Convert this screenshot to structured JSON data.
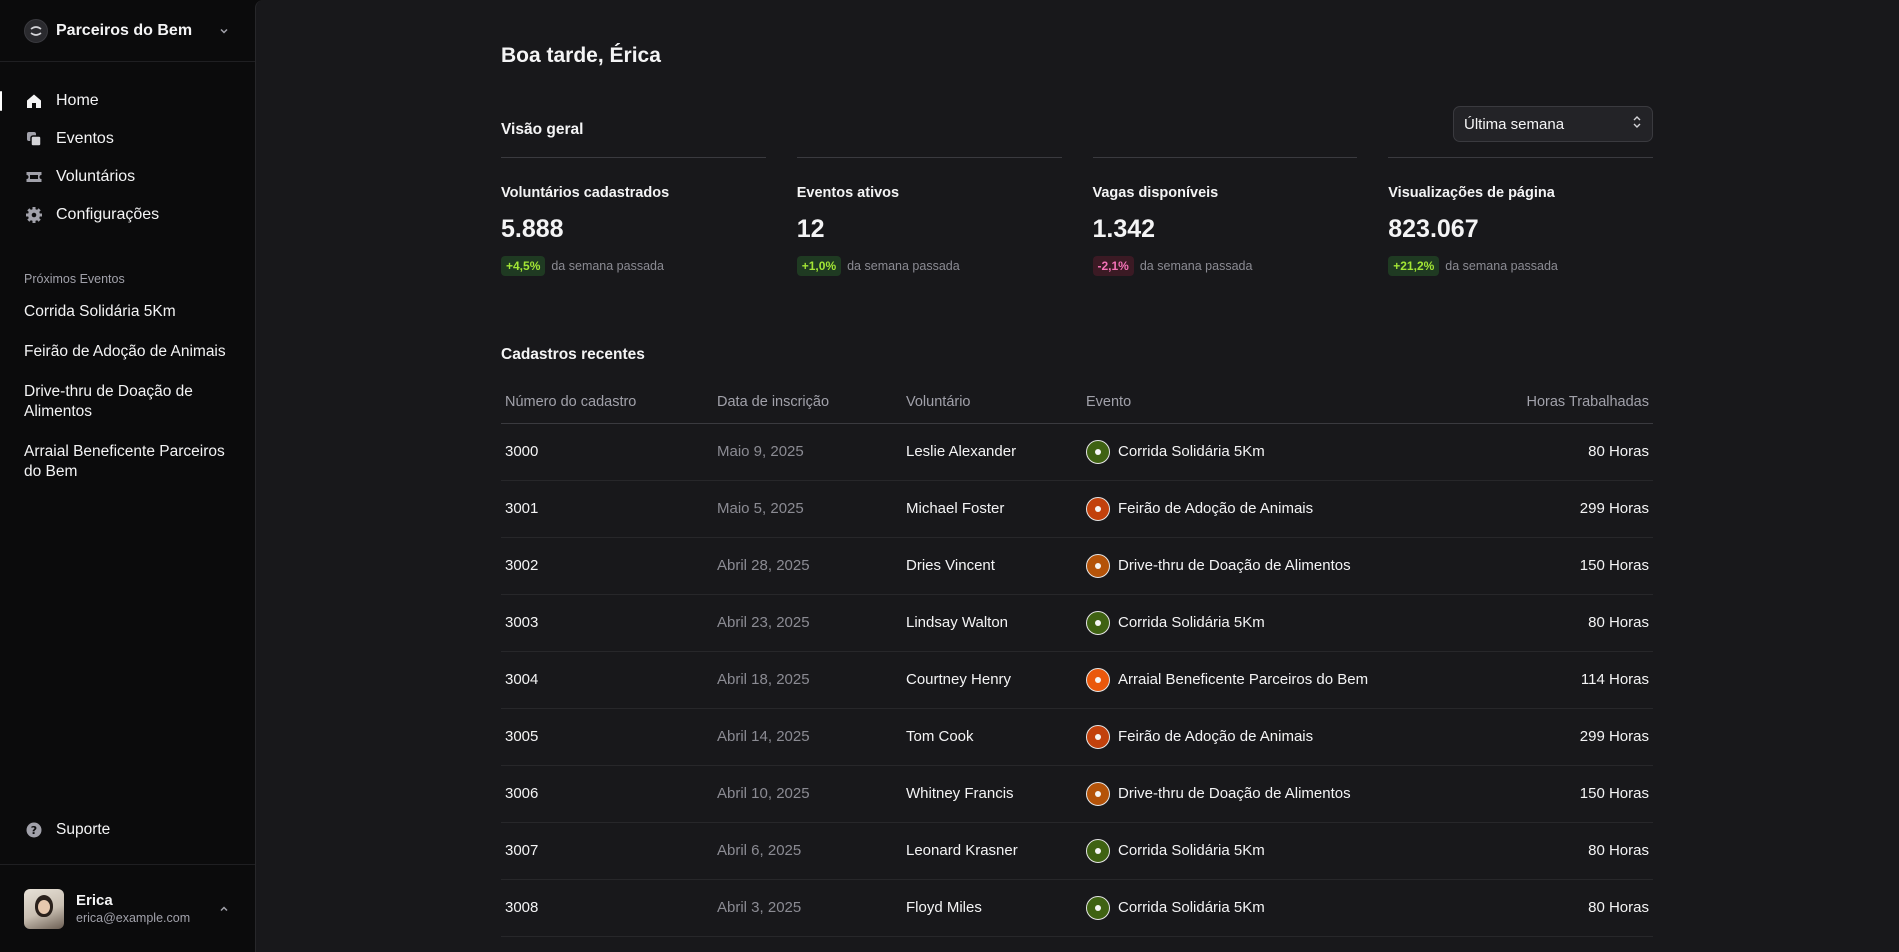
{
  "brand": {
    "name": "Parceiros do Bem"
  },
  "nav": [
    {
      "label": "Home",
      "icon": "home-icon",
      "active": true
    },
    {
      "label": "Eventos",
      "icon": "squares-icon",
      "active": false
    },
    {
      "label": "Voluntários",
      "icon": "ticket-icon",
      "active": false
    },
    {
      "label": "Configurações",
      "icon": "gear-icon",
      "active": false
    }
  ],
  "upcoming": {
    "label": "Próximos Eventos",
    "events": [
      "Corrida Solidária 5Km",
      "Feirão de Adoção de Animais",
      "Drive-thru de Doação de Alimentos",
      "Arraial Beneficente Parceiros do Bem"
    ]
  },
  "support": {
    "label": "Suporte"
  },
  "user": {
    "name": "Erica",
    "email": "erica@example.com"
  },
  "main": {
    "greeting": "Boa tarde, Érica",
    "overview_title": "Visão geral",
    "period": "Última semana",
    "stats": [
      {
        "label": "Voluntários cadastrados",
        "value": "5.888",
        "change": "+4,5%",
        "positive": true,
        "suffix": "da semana passada"
      },
      {
        "label": "Eventos ativos",
        "value": "12",
        "change": "+1,0%",
        "positive": true,
        "suffix": "da semana passada"
      },
      {
        "label": "Vagas disponíveis",
        "value": "1.342",
        "change": "-2,1%",
        "positive": false,
        "suffix": "da semana passada"
      },
      {
        "label": "Visualizações de página",
        "value": "823.067",
        "change": "+21,2%",
        "positive": true,
        "suffix": "da semana passada"
      }
    ],
    "recent_title": "Cadastros recentes",
    "table": {
      "headers": [
        "Número do cadastro",
        "Data de inscrição",
        "Voluntário",
        "Evento",
        "Horas Trabalhadas"
      ],
      "rows": [
        {
          "num": "3000",
          "date": "Maio 9, 2025",
          "volunteer": "Leslie Alexander",
          "event": "Corrida Solidária 5Km",
          "hours": "80 Horas",
          "color": "#3f6212"
        },
        {
          "num": "3001",
          "date": "Maio 5, 2025",
          "volunteer": "Michael Foster",
          "event": "Feirão de Adoção de Animais",
          "hours": "299 Horas",
          "color": "#c2410c"
        },
        {
          "num": "3002",
          "date": "Abril 28, 2025",
          "volunteer": "Dries Vincent",
          "event": "Drive-thru de Doação de Alimentos",
          "hours": "150 Horas",
          "color": "#b45309"
        },
        {
          "num": "3003",
          "date": "Abril 23, 2025",
          "volunteer": "Lindsay Walton",
          "event": "Corrida Solidária 5Km",
          "hours": "80 Horas",
          "color": "#3f6212"
        },
        {
          "num": "3004",
          "date": "Abril 18, 2025",
          "volunteer": "Courtney Henry",
          "event": "Arraial Beneficente Parceiros do Bem",
          "hours": "114 Horas",
          "color": "#ea580c"
        },
        {
          "num": "3005",
          "date": "Abril 14, 2025",
          "volunteer": "Tom Cook",
          "event": "Feirão de Adoção de Animais",
          "hours": "299 Horas",
          "color": "#c2410c"
        },
        {
          "num": "3006",
          "date": "Abril 10, 2025",
          "volunteer": "Whitney Francis",
          "event": "Drive-thru de Doação de Alimentos",
          "hours": "150 Horas",
          "color": "#b45309"
        },
        {
          "num": "3007",
          "date": "Abril 6, 2025",
          "volunteer": "Leonard Krasner",
          "event": "Corrida Solidária 5Km",
          "hours": "80 Horas",
          "color": "#3f6212"
        },
        {
          "num": "3008",
          "date": "Abril 3, 2025",
          "volunteer": "Floyd Miles",
          "event": "Corrida Solidária 5Km",
          "hours": "80 Horas",
          "color": "#3f6212"
        }
      ]
    }
  }
}
